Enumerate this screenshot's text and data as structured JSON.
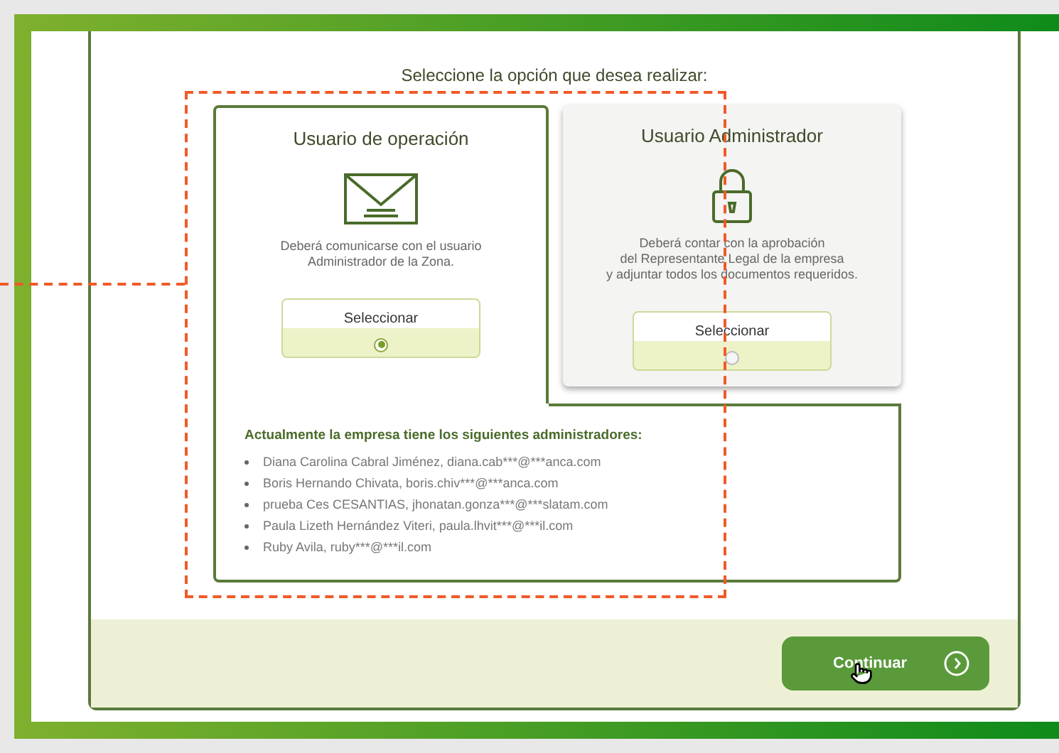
{
  "heading": "Seleccione la opción que desea realizar:",
  "options": [
    {
      "kind": "mail",
      "title": "Usuario de operación",
      "description": "Deberá comunicarse con el usuario\nAdministrador de la Zona.",
      "button": "Seleccionar",
      "selected": true
    },
    {
      "kind": "lock",
      "title": "Usuario Administrador",
      "description": "Deberá contar con la aprobación\ndel Representante Legal de la empresa\ny adjuntar todos los documentos requeridos.",
      "button": "Seleccionar",
      "selected": false
    }
  ],
  "administrators": {
    "title": "Actualmente la empresa tiene los siguientes administradores:",
    "items": [
      "Diana Carolina Cabral Jiménez, diana.cab***@***anca.com",
      "Boris Hernando Chivata, boris.chiv***@***anca.com",
      "prueba Ces CESANTIAS, jhonatan.gonza***@***slatam.com",
      "Paula Lizeth Hernández Viteri, paula.lhvit***@***il.com",
      "Ruby Avila, ruby***@***il.com"
    ]
  },
  "continue_button": "Continuar"
}
